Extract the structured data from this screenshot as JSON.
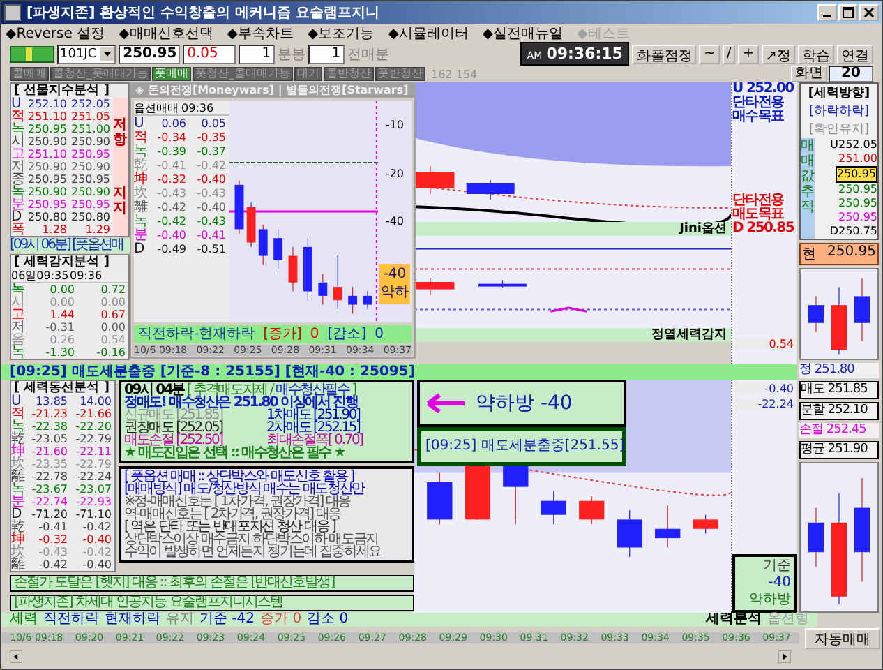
{
  "window": {
    "title": "[파생지존] 환상적인 수익창출의 메커니즘 요술램프지니"
  },
  "menu": [
    {
      "label": "◆Reverse 설정",
      "disabled": false
    },
    {
      "label": "◆매매신호선택",
      "disabled": false
    },
    {
      "label": "◆부속차트",
      "disabled": false
    },
    {
      "label": "◆보조기능",
      "disabled": false
    },
    {
      "label": "◆시뮬레이터",
      "disabled": false
    },
    {
      "label": "◆실전매뉴얼",
      "disabled": false
    },
    {
      "label": "◆테스트",
      "disabled": true
    }
  ],
  "toolbar": {
    "symbol": "101JC",
    "price": "250.95",
    "change": "0.05",
    "bar_count": "1",
    "bar_unit": "분봉",
    "lookback": "1",
    "lookback_unit": "전매분",
    "clock_ampm": "AM",
    "clock_time": "09:36:15",
    "buttons": [
      "화폴점정",
      "~",
      "/",
      "+",
      "↗정",
      "학습",
      "연결"
    ]
  },
  "mode_buttons": [
    {
      "label": "콜매매",
      "selected": false
    },
    {
      "label": "콜청산_풋매매가능",
      "selected": false
    },
    {
      "label": "풋매매",
      "selected": true
    },
    {
      "label": "풋청산_콜매매가능",
      "selected": false
    },
    {
      "label": "대기",
      "selected": false
    },
    {
      "label": "콜반청산",
      "selected": false
    },
    {
      "label": "풋반청산",
      "selected": false
    }
  ],
  "mode_info": "162 154",
  "screen": {
    "label": "화면",
    "value": "20"
  },
  "futures_panel": {
    "title": "[ 선물지수분석 ]",
    "side_labels": [
      "저항",
      "지지"
    ],
    "rows": [
      {
        "label": "U",
        "v1": "252.10",
        "v2": "252.05",
        "color": "#2020a0"
      },
      {
        "label": "적",
        "v1": "251.10",
        "v2": "251.05",
        "color": "#e00000"
      },
      {
        "label": "녹",
        "v1": "250.95",
        "v2": "251.00",
        "color": "#008000"
      },
      {
        "label": "시",
        "v1": "250.90",
        "v2": "250.90",
        "color": "#404040"
      },
      {
        "label": "고",
        "v1": "251.10",
        "v2": "250.95",
        "color": "#e000e0"
      },
      {
        "label": "저",
        "v1": "250.90",
        "v2": "250.90",
        "color": "#606060"
      },
      {
        "label": "종",
        "v1": "250.95",
        "v2": "250.95",
        "color": "#404040"
      },
      {
        "label": "녹",
        "v1": "250.90",
        "v2": "250.90",
        "color": "#008000"
      },
      {
        "label": "분",
        "v1": "250.95",
        "v2": "250.95",
        "color": "#e000e0"
      },
      {
        "label": "D",
        "v1": "250.80",
        "v2": "250.80",
        "color": "#202020"
      },
      {
        "label": "폭",
        "v1": "1.28",
        "v2": "1.29",
        "color": "#e00000"
      }
    ]
  },
  "time_strip": "[09시 06분] [풋옵션매",
  "power_panel": {
    "title": "[ 세력감지분석 ]",
    "head1": "06일09:35",
    "head2": "09:36",
    "rows": [
      {
        "label": "녹",
        "v1": "0.00",
        "v2": "0.72",
        "color": "#008000"
      },
      {
        "label": "시",
        "v1": "0.00",
        "v2": "0.00",
        "color": "#909090"
      },
      {
        "label": "고",
        "v1": "1.44",
        "v2": "0.67",
        "color": "#e00000"
      },
      {
        "label": "저",
        "v1": "-0.31",
        "v2": "0.00",
        "color": "#606060"
      },
      {
        "label": "음",
        "v1": "0.26",
        "v2": "0.54",
        "color": "#909090"
      },
      {
        "label": "녹",
        "v1": "-1.30",
        "v2": "-0.16",
        "color": "#008000"
      }
    ]
  },
  "alert_bar": "[09:25] 매도세분출중 [기준-8 : 25155] [현재-40 : 25095]",
  "top_chart": {
    "label": "Jini옵션",
    "upper_target": [
      "U 252.00",
      "단타전용",
      "매수목표"
    ],
    "lower_target": [
      "단타전용",
      "매도목표",
      "D 250.85"
    ]
  },
  "mid_chart": {
    "label": "정열세력감지",
    "reading": "0.54"
  },
  "popup": {
    "title": "◈ 돈의전쟁[Moneywars] | 별들의전쟁[Starwars]",
    "head1": "옵션매매",
    "head2": "09:36",
    "rows": [
      {
        "label": "U",
        "v1": "0.06",
        "v2": "0.05",
        "color": "#2020a0"
      },
      {
        "label": "적",
        "v1": "-0.34",
        "v2": "-0.35",
        "color": "#e00000"
      },
      {
        "label": "녹",
        "v1": "-0.39",
        "v2": "-0.37",
        "color": "#008000"
      },
      {
        "label": "乾",
        "v1": "-0.41",
        "v2": "-0.42",
        "color": "#909090"
      },
      {
        "label": "坤",
        "v1": "-0.32",
        "v2": "-0.40",
        "color": "#e00000"
      },
      {
        "label": "坎",
        "v1": "-0.43",
        "v2": "-0.43",
        "color": "#909090"
      },
      {
        "label": "離",
        "v1": "-0.42",
        "v2": "-0.40",
        "color": "#606060"
      },
      {
        "label": "녹",
        "v1": "-0.42",
        "v2": "-0.43",
        "color": "#008000"
      },
      {
        "label": "분",
        "v1": "-0.40",
        "v2": "-0.41",
        "color": "#e000e0"
      },
      {
        "label": "D",
        "v1": "-0.49",
        "v2": "-0.51",
        "color": "#202020"
      }
    ],
    "axis_labels": [
      "-10",
      "-20",
      "-40"
    ],
    "badge": [
      "-40",
      "약하"
    ],
    "footer": {
      "label": "직전하락-현재하락",
      "inc_label": "[증가]",
      "inc": "0",
      "dec_label": "[감소]",
      "dec": "0"
    },
    "times": [
      "10/6 09:18",
      "09:22",
      "09:25",
      "09:28",
      "09:31",
      "09:34",
      "09:37"
    ]
  },
  "flow_panel": {
    "title": "[ 세력동선분석 ]",
    "rows": [
      {
        "label": "U",
        "v1": "13.85",
        "v2": "14.00",
        "color": "#2020a0"
      },
      {
        "label": "적",
        "v1": "-21.23",
        "v2": "-21.66",
        "color": "#e00000"
      },
      {
        "label": "녹",
        "v1": "-22.38",
        "v2": "-22.20",
        "color": "#008000"
      },
      {
        "label": "乾",
        "v1": "-23.05",
        "v2": "-22.79",
        "color": "#404040"
      },
      {
        "label": "坤",
        "v1": "-21.60",
        "v2": "-22.11",
        "color": "#e000e0"
      },
      {
        "label": "坎",
        "v1": "-23.35",
        "v2": "-22.79",
        "color": "#909090"
      },
      {
        "label": "離",
        "v1": "-22.78",
        "v2": "-22.24",
        "color": "#404040"
      },
      {
        "label": "녹",
        "v1": "-23.67",
        "v2": "-23.07",
        "color": "#008000"
      },
      {
        "label": "분",
        "v1": "-22.74",
        "v2": "-22.93",
        "color": "#e000e0"
      },
      {
        "label": "D",
        "v1": "-71.20",
        "v2": "-71.10",
        "color": "#202020"
      },
      {
        "label": "乾",
        "v1": "-0.41",
        "v2": "-0.42",
        "color": "#404040"
      },
      {
        "label": "坤",
        "v1": "-0.32",
        "v2": "-0.40",
        "color": "#e00000"
      },
      {
        "label": "坎",
        "v1": "-0.43",
        "v2": "-0.42",
        "color": "#909090"
      },
      {
        "label": "離",
        "v1": "-0.42",
        "v2": "-0.40",
        "color": "#404040"
      }
    ]
  },
  "advice": {
    "time": "09시 04분",
    "title_a": "[ 추격매도자제 / ",
    "title_b": "매수청산필수",
    "title_c": " ]",
    "headline": "정매도! 매수청산은 251.80 이상에서 진행",
    "prices": [
      {
        "label": "신규매도 [251.85]",
        "kind": "muted"
      },
      {
        "label": "1차매도 [251.90]",
        "kind": "blue"
      },
      {
        "label": "권장매도 [252.05]",
        "kind": "dark"
      },
      {
        "label": "2차매도 [252.15]",
        "kind": "blue"
      },
      {
        "label": "매도손절 [252.50]",
        "kind": "purple"
      },
      {
        "label": "최대손절폭[ 0.70]",
        "kind": "purple"
      }
    ],
    "motto": "★ 매도진입은 선택 :: 매수청산은 필수 ★",
    "lines": [
      {
        "text": "[ 풋옵션 매매 :: 상단박스와 매도신호 활용 ]",
        "kind": "blue"
      },
      {
        "text": "[매매방식] 매도/청산방식 매수는 매도청산만",
        "kind": "blue"
      },
      {
        "text": "※정-매매신호는 [ 1차가격, 권장가격] 대응",
        "kind": "grey"
      },
      {
        "text": "역-매매신호는 [ 2차가격, 권장가격] 대응",
        "kind": "grey"
      },
      {
        "text": "[ 역은 단타 또는 반대포지션 청산 대응 ]",
        "kind": "dark"
      },
      {
        "text": "상단박스이상 매수금지  하단박스이하 매도금지",
        "kind": "grey"
      },
      {
        "text": "수익이 발생하면 언제든지 챙기는데 집중하세요",
        "kind": "grey"
      }
    ]
  },
  "notes": [
    "손절가 도달은 [헷지] 대응 :: 최후의 손절은 [반대신호발생]",
    "[파생지존] 차세대 인공지능 요술램프지니시스템"
  ],
  "callout": {
    "text": "약하방 -40",
    "box": "[09:25] 매도세분출중[251.55]"
  },
  "lower_chart": {
    "readings": [
      "-0.40",
      "-22.24"
    ],
    "base": [
      "기준",
      "-40",
      "약하방"
    ],
    "label": "세력분석",
    "mode": "옵션형"
  },
  "status": [
    {
      "text": "세력",
      "color": "#008000"
    },
    {
      "text": "직전하락",
      "color": "#0000c0"
    },
    {
      "text": "현재하락",
      "color": "#0000c0"
    },
    {
      "text": "유지",
      "color": "#808080"
    },
    {
      "text": "기준 -42",
      "color": "#0000c0"
    },
    {
      "text": "증가 0",
      "color": "#e04040"
    },
    {
      "text": "감소 0",
      "color": "#0000c0"
    }
  ],
  "time_axis": [
    "10/6 09:18",
    "09:20",
    "09:21",
    "09:22",
    "09:23",
    "09:24",
    "09:25",
    "09:26",
    "09:27",
    "09:28",
    "09:29",
    "09:30",
    "09:31",
    "09:32",
    "09:33",
    "09:34",
    "09:35",
    "09:36",
    "09:37"
  ],
  "direction_panel": {
    "title": "[세력방향]",
    "state": "[하락하락]",
    "confirm": "[확인유지]",
    "tracker": "매매값추적",
    "values": [
      {
        "text": "U252.05",
        "color": "#000000",
        "selected": false
      },
      {
        "text": "251.00",
        "color": "#e00000",
        "selected": false
      },
      {
        "text": "250.95",
        "color": "#000000",
        "selected": true
      },
      {
        "text": "250.95",
        "color": "#008000",
        "selected": false
      },
      {
        "text": "250.95",
        "color": "#008000",
        "selected": false
      },
      {
        "text": "250.95",
        "color": "#e000e0",
        "selected": false
      },
      {
        "text": "D250.75",
        "color": "#000000",
        "selected": false
      }
    ]
  },
  "current": {
    "label": "현",
    "value": "250.95"
  },
  "orders": [
    {
      "label": "정",
      "value": "251.80",
      "kind": "plain"
    },
    {
      "label": "매도",
      "value": "251.85",
      "kind": "boxed"
    },
    {
      "label": "분할",
      "value": "252.10",
      "kind": "boxed"
    },
    {
      "label": "손절",
      "value": "252.45",
      "kind": "pink"
    },
    {
      "label": "평균",
      "value": "251.90",
      "kind": "boxed"
    }
  ],
  "auto_button": "자동매매"
}
